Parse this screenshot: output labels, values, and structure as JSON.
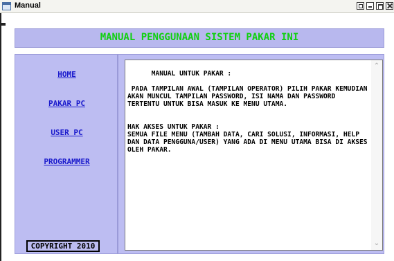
{
  "window": {
    "title": "Manual"
  },
  "header": {
    "title": "MANUAL PENGGUNAAN SISTEM PAKAR INI"
  },
  "sidebar": {
    "links": [
      {
        "label": "HOME"
      },
      {
        "label": "PAKAR PC"
      },
      {
        "label": "USER PC"
      },
      {
        "label": "PROGRAMMER"
      }
    ],
    "copyright": "COPYRIGHT 2010"
  },
  "content": {
    "text": "MANUAL UNTUK PAKAR :\n\n PADA TAMPILAN AWAL (TAMPILAN OPERATOR) PILIH PAKAR KEMUDIAN AKAN MUNCUL TAMPILAN PASSWORD, ISI NAMA DAN PASSWORD TERTENTU UNTUK BISA MASUK KE MENU UTAMA.\n\n\nHAK AKSES UNTUK PAKAR :\nSEMUA FILE MENU (TAMBAH DATA, CARI SOLUSI, INFORMASI, HELP DAN DATA PENGGUNA/USER) YANG ADA DI MENU UTAMA BISA DI AKSES OLEH PAKAR."
  },
  "colors": {
    "panel_bg": "#bdbdf2",
    "title_green": "#10d010",
    "link_blue": "#1a1acc"
  }
}
